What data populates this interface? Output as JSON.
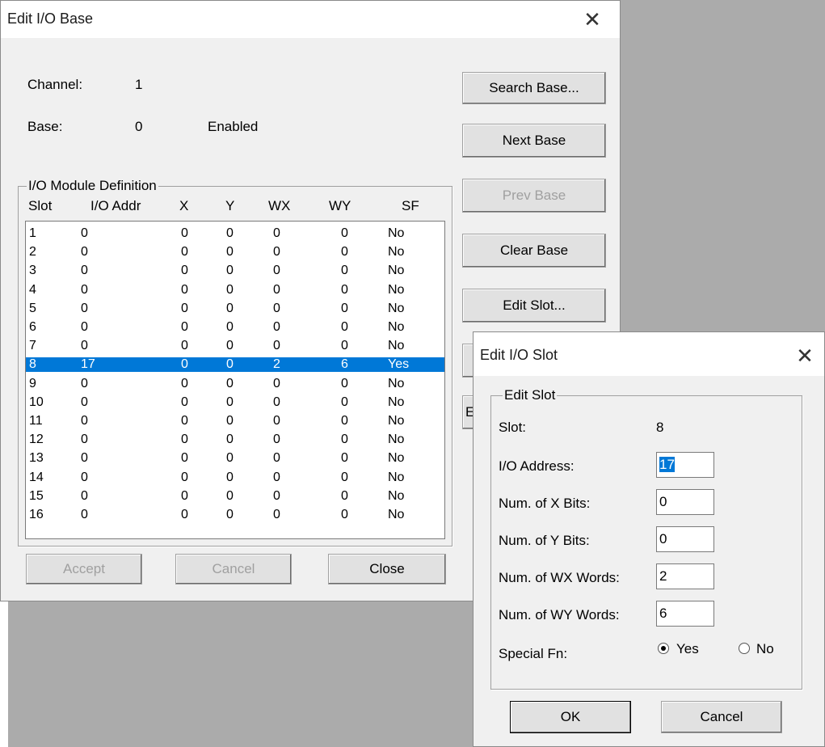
{
  "base_dialog": {
    "title": "Edit I/O Base",
    "channel_label": "Channel:",
    "channel_value": "1",
    "base_label": "Base:",
    "base_value": "0",
    "base_status": "Enabled",
    "group_title": "I/O Module Definition",
    "columns": [
      "Slot",
      "I/O Addr",
      "X",
      "Y",
      "WX",
      "WY",
      "SF"
    ],
    "rows": [
      [
        "1",
        "0",
        "0",
        "0",
        "0",
        "0",
        "No"
      ],
      [
        "2",
        "0",
        "0",
        "0",
        "0",
        "0",
        "No"
      ],
      [
        "3",
        "0",
        "0",
        "0",
        "0",
        "0",
        "No"
      ],
      [
        "4",
        "0",
        "0",
        "0",
        "0",
        "0",
        "No"
      ],
      [
        "5",
        "0",
        "0",
        "0",
        "0",
        "0",
        "No"
      ],
      [
        "6",
        "0",
        "0",
        "0",
        "0",
        "0",
        "No"
      ],
      [
        "7",
        "0",
        "0",
        "0",
        "0",
        "0",
        "No"
      ],
      [
        "8",
        "17",
        "0",
        "0",
        "2",
        "6",
        "Yes"
      ],
      [
        "9",
        "0",
        "0",
        "0",
        "0",
        "0",
        "No"
      ],
      [
        "10",
        "0",
        "0",
        "0",
        "0",
        "0",
        "No"
      ],
      [
        "11",
        "0",
        "0",
        "0",
        "0",
        "0",
        "No"
      ],
      [
        "12",
        "0",
        "0",
        "0",
        "0",
        "0",
        "No"
      ],
      [
        "13",
        "0",
        "0",
        "0",
        "0",
        "0",
        "No"
      ],
      [
        "14",
        "0",
        "0",
        "0",
        "0",
        "0",
        "No"
      ],
      [
        "15",
        "0",
        "0",
        "0",
        "0",
        "0",
        "No"
      ],
      [
        "16",
        "0",
        "0",
        "0",
        "0",
        "0",
        "No"
      ]
    ],
    "selected_row": 7,
    "buttons": {
      "search_base": "Search Base...",
      "next_base": "Next Base",
      "prev_base": "Prev Base",
      "clear_base": "Clear Base",
      "edit_slot": "Edit Slot...",
      "partial": "E",
      "accept": "Accept",
      "cancel": "Cancel",
      "close": "Close"
    }
  },
  "slot_dialog": {
    "title": "Edit I/O Slot",
    "group_title": "Edit Slot",
    "slot_label": "Slot:",
    "slot_value": "8",
    "io_address_label": "I/O Address:",
    "io_address_value": "17",
    "x_bits_label": "Num. of X Bits:",
    "x_bits_value": "0",
    "y_bits_label": "Num. of Y Bits:",
    "y_bits_value": "0",
    "wx_words_label": "Num. of WX Words:",
    "wx_words_value": "2",
    "wy_words_label": "Num. of WY Words:",
    "wy_words_value": "6",
    "special_fn_label": "Special Fn:",
    "yes_label": "Yes",
    "no_label": "No",
    "special_fn_selected": "Yes",
    "ok_label": "OK",
    "cancel_label": "Cancel"
  },
  "icons": {
    "close": "close-icon"
  },
  "colors": {
    "selection": "#0078d7",
    "desktop": "#ababab",
    "dialog_bg": "#f0f0f0"
  }
}
